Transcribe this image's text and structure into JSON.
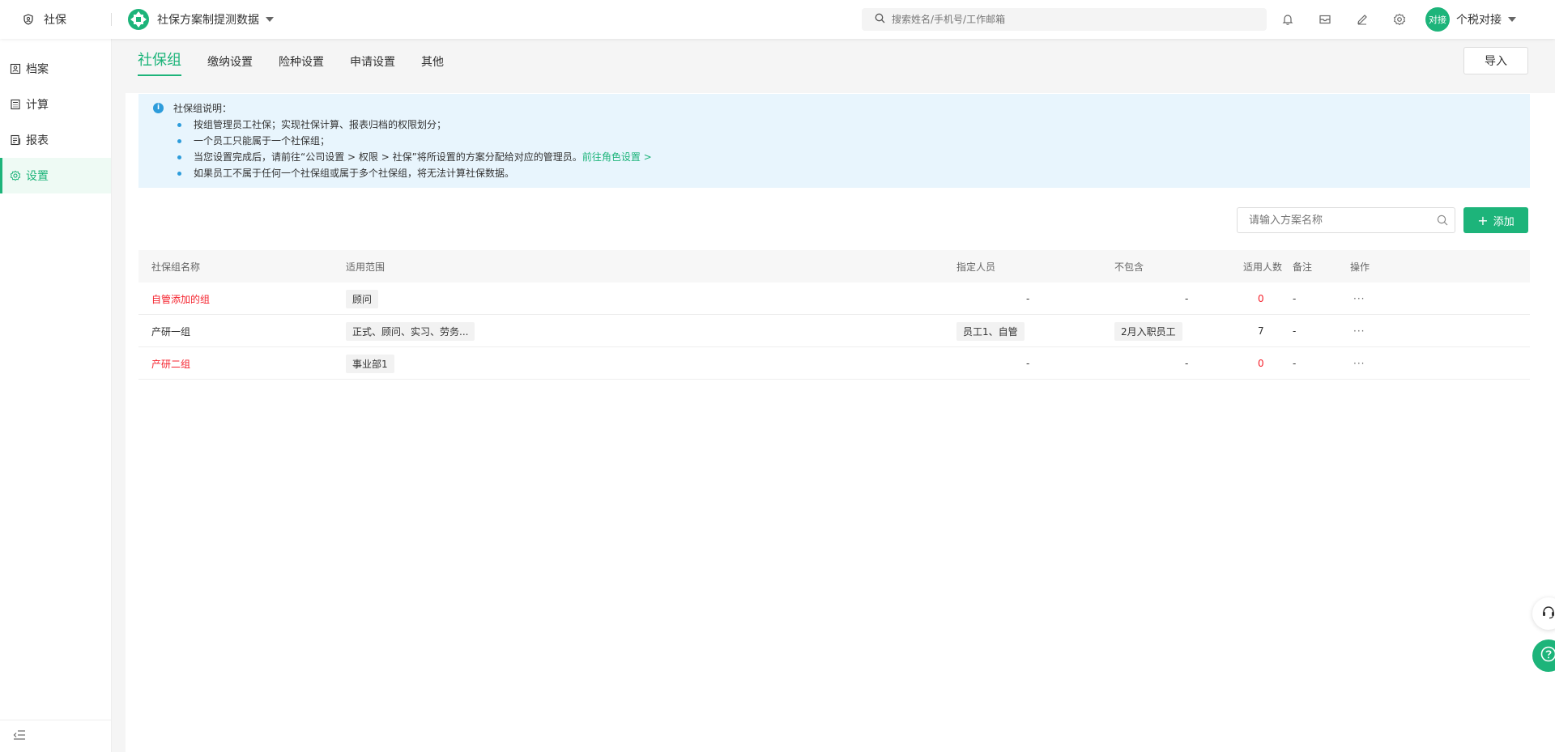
{
  "header": {
    "module_label": "社保",
    "tenant_name": "社保方案制提测数据",
    "search_placeholder": "搜索姓名/手机号/工作邮箱",
    "user_avatar_text": "对接",
    "user_name": "个税对接"
  },
  "sidebar": {
    "items": [
      {
        "label": "档案",
        "icon": "profile-icon"
      },
      {
        "label": "计算",
        "icon": "calculator-icon"
      },
      {
        "label": "报表",
        "icon": "report-icon"
      },
      {
        "label": "设置",
        "icon": "gear-icon",
        "active": true
      }
    ]
  },
  "tabs": [
    {
      "label": "社保组",
      "active": true
    },
    {
      "label": "缴纳设置"
    },
    {
      "label": "险种设置"
    },
    {
      "label": "申请设置"
    },
    {
      "label": "其他"
    }
  ],
  "import_label": "导入",
  "notice": {
    "title": "社保组说明：",
    "items": [
      "按组管理员工社保；实现社保计算、报表归档的权限划分；",
      "一个员工只能属于一个社保组；",
      "当您设置完成后，请前往“公司设置 > 权限 > 社保”将所设置的方案分配给对应的管理员。",
      "如果员工不属于任何一个社保组或属于多个社保组，将无法计算社保数据。"
    ],
    "link": "前往角色设置 >"
  },
  "plan_search_placeholder": "请输入方案名称",
  "add_label": "添加",
  "table": {
    "headers": {
      "name": "社保组名称",
      "scope": "适用范围",
      "assigned": "指定人员",
      "exclude": "不包含",
      "count": "适用人数",
      "note": "备注",
      "op": "操作"
    },
    "rows": [
      {
        "name": "自管添加的组",
        "scope": "顾问",
        "assigned": "-",
        "exclude": "-",
        "count": "0",
        "note": "-",
        "op": "···"
      },
      {
        "name": "产研一组",
        "scope": "正式、顾问、实习、劳务...",
        "assigned": "员工1、自管",
        "exclude": "2月入职员工",
        "count": "7",
        "note": "-",
        "op": "···"
      },
      {
        "name": "产研二组",
        "scope": "事业部1",
        "assigned": "-",
        "exclude": "-",
        "count": "0",
        "note": "-",
        "op": "···"
      }
    ]
  },
  "colors": {
    "accent": "#1db47a",
    "alert": "#f5222d",
    "info": "#2d9cdb"
  }
}
